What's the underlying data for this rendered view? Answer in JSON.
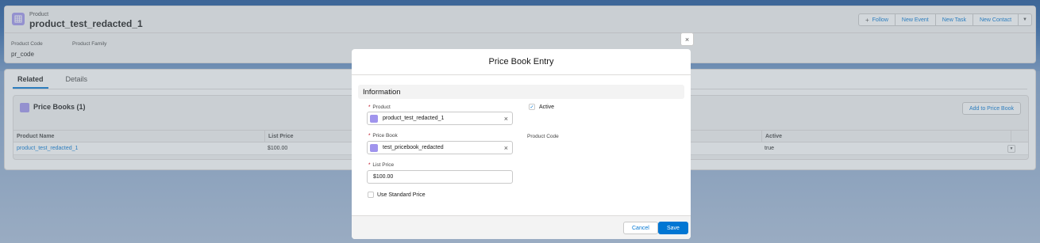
{
  "header": {
    "object_type": "Product",
    "record_title": "product_test_redacted_1",
    "buttons": {
      "follow": "Follow",
      "new_event": "New Event",
      "new_task": "New Task",
      "new_contact": "New Contact"
    },
    "fields": [
      {
        "label": "Product Code",
        "value": "pr_code"
      },
      {
        "label": "Product Family",
        "value": ""
      }
    ]
  },
  "tabs": [
    "Related",
    "Details"
  ],
  "related_list": {
    "title": "Price Books (1)",
    "add_button": "Add to Price Book",
    "columns": [
      "Product Name",
      "List Price",
      "Active"
    ],
    "rows": [
      {
        "product_name": "product_test_redacted_1",
        "list_price": "$100.00",
        "active": "true"
      }
    ]
  },
  "modal": {
    "title": "Price Book Entry",
    "section": "Information",
    "product_label": "Product",
    "product_value": "product_test_redacted_1",
    "pricebook_label": "Price Book",
    "pricebook_value": "test_pricebook_redacted",
    "list_price_label": "List Price",
    "list_price_value": "$100.00",
    "use_standard_label": "Use Standard Price",
    "use_standard_checked": false,
    "active_label": "Active",
    "active_checked": true,
    "product_code_label": "Product Code",
    "required_mark": "*",
    "cancel": "Cancel",
    "save": "Save"
  },
  "icons": {
    "close": "×",
    "clear": "×",
    "check": "✓",
    "plus": "+",
    "dropdown": "▼"
  },
  "colors": {
    "brand_blue": "#0176d3",
    "object_purple": "#a094ed"
  }
}
